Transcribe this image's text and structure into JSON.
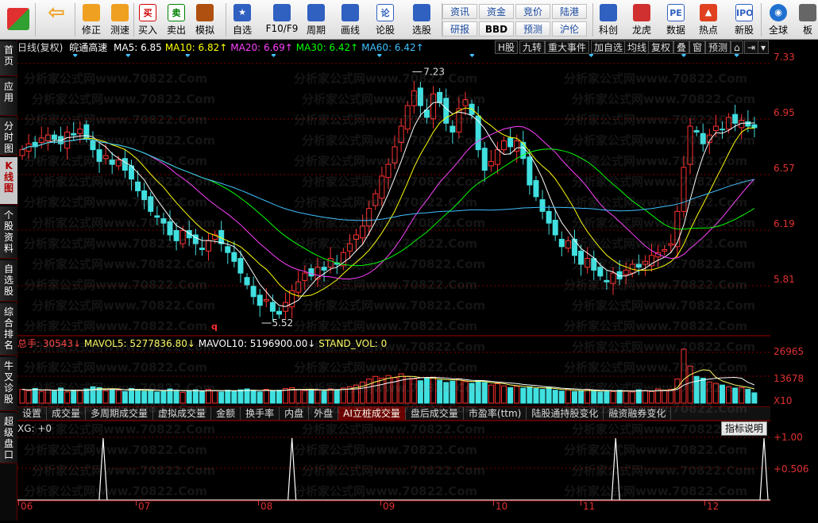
{
  "toolbar": {
    "buttons": [
      {
        "label": "",
        "name": "home-button",
        "icon": "app-logo",
        "color": "#e03030"
      },
      {
        "label": "",
        "name": "back-button",
        "icon": "arrow-left",
        "color": "#f0a020"
      },
      {
        "label": "修正",
        "name": "repair-button",
        "icon": "clock-icon",
        "color": "#f0a020"
      },
      {
        "label": "测速",
        "name": "speedtest-button",
        "icon": "stopwatch-icon",
        "color": "#f0a020"
      },
      {
        "label": "买入",
        "name": "buy-button",
        "icon": "buy-icon",
        "color": "#d00000",
        "glyph": "买"
      },
      {
        "label": "卖出",
        "name": "sell-button",
        "icon": "sell-icon",
        "color": "#008000",
        "glyph": "卖"
      },
      {
        "label": "模拟",
        "name": "simulate-button",
        "icon": "hammer-icon",
        "color": "#b05010"
      },
      {
        "label": "自选",
        "name": "watchlist-button",
        "icon": "star-icon",
        "color": "#3060c0"
      },
      {
        "label": "F10/F9",
        "name": "f10-button",
        "icon": "doc-icon",
        "color": "#3060c0"
      },
      {
        "label": "周期",
        "name": "period-button",
        "icon": "cycle-icon",
        "color": "#3060c0"
      },
      {
        "label": "画线",
        "name": "drawline-button",
        "icon": "pen-icon",
        "color": "#3060c0"
      },
      {
        "label": "论股",
        "name": "forum-button",
        "icon": "forum-icon",
        "color": "#3060c0",
        "glyph": "论"
      },
      {
        "label": "选股",
        "name": "stockpick-button",
        "icon": "gauge-icon",
        "color": "#3060c0"
      },
      {
        "label": "科创",
        "name": "star-market-button",
        "icon": "chart-icon",
        "color": "#3060c0"
      },
      {
        "label": "龙虎",
        "name": "dragon-tiger-button",
        "icon": "dragon-icon",
        "color": "#d03030"
      },
      {
        "label": "数据",
        "name": "data-button",
        "icon": "pe-icon",
        "color": "#3060c0",
        "glyph": "PE"
      },
      {
        "label": "热点",
        "name": "hotspot-button",
        "icon": "fire-icon",
        "color": "#e04020"
      },
      {
        "label": "新股",
        "name": "ipo-button",
        "icon": "ipo-icon",
        "color": "#3060c0",
        "glyph": "IPO"
      },
      {
        "label": "全球",
        "name": "global-button",
        "icon": "globe-icon",
        "color": "#2070d0"
      },
      {
        "label": "板",
        "name": "sector-button",
        "icon": "sector-icon",
        "color": "#666"
      }
    ],
    "mini": [
      {
        "label": "资讯",
        "name": "news-button"
      },
      {
        "label": "资金",
        "name": "fund-button"
      },
      {
        "label": "竞价",
        "name": "auction-button"
      },
      {
        "label": "陆港",
        "name": "connect-button"
      },
      {
        "label": "研报",
        "name": "research-button"
      },
      {
        "label": "BBD",
        "name": "bbd-button"
      },
      {
        "label": "预测",
        "name": "forecast-button"
      },
      {
        "label": "沪伦",
        "name": "shanghai-london-button"
      }
    ]
  },
  "sidetabs": [
    {
      "label": "首页",
      "name": "tab-home"
    },
    {
      "label": "应用",
      "name": "tab-apps",
      "arrow": true
    },
    {
      "label": "分时图",
      "name": "tab-intraday"
    },
    {
      "label": "K线图",
      "name": "tab-kline",
      "active": true
    },
    {
      "label": "个股资料",
      "name": "tab-stock-info"
    },
    {
      "label": "自选股",
      "name": "tab-watchlist"
    },
    {
      "label": "综合排名",
      "name": "tab-ranking"
    },
    {
      "label": "牛叉诊股",
      "name": "tab-diagnosis"
    },
    {
      "label": "超级盘口",
      "name": "tab-super-orderbook"
    }
  ],
  "chart_head": {
    "period": "日线(复权)",
    "stock": "皖通高速",
    "ma": [
      {
        "label": "MA5: 6.85",
        "color": "#ffffff"
      },
      {
        "label": "MA10: 6.82↑",
        "color": "#ffff00"
      },
      {
        "label": "MA20: 6.69↑",
        "color": "#ff40ff"
      },
      {
        "label": "MA30: 6.42↑",
        "color": "#00ff00"
      },
      {
        "label": "MA60: 6.42↑",
        "color": "#40c0ff"
      }
    ],
    "menu": [
      "H股",
      "九转",
      "重大事件",
      "加自选",
      "均线",
      "复权",
      "叠",
      "窗",
      "预测"
    ]
  },
  "price_axis": [
    "7.33",
    "6.95",
    "6.57",
    "6.19",
    "5.81"
  ],
  "price_annotations": {
    "high": "7.23",
    "low": "5.52"
  },
  "volume_head": {
    "total": "总手: 30543↓",
    "mavol5": "MAVOL5: 5277836.80↓",
    "mavol10": "MAVOL10: 5196900.00↓",
    "stand": "STAND_VOL: 0"
  },
  "volume_axis": [
    "26965",
    "13678",
    "X10"
  ],
  "indicator_tabs": [
    {
      "label": "设置",
      "name": "itab-settings"
    },
    {
      "label": "成交量",
      "name": "itab-volume"
    },
    {
      "label": "多周期成交量",
      "name": "itab-multi-volume"
    },
    {
      "label": "虚拟成交量",
      "name": "itab-virtual-volume"
    },
    {
      "label": "金额",
      "name": "itab-amount"
    },
    {
      "label": "换手率",
      "name": "itab-turnover"
    },
    {
      "label": "内盘",
      "name": "itab-inner"
    },
    {
      "label": "外盘",
      "name": "itab-outer"
    },
    {
      "label": "AI立桩成交量",
      "name": "itab-ai-volume",
      "active": true
    },
    {
      "label": "盘后成交量",
      "name": "itab-after-hours"
    },
    {
      "label": "市盈率(ttm)",
      "name": "itab-pe"
    },
    {
      "label": "陆股通持股变化",
      "name": "itab-connect-holding"
    },
    {
      "label": "融资融券变化",
      "name": "itab-margin"
    }
  ],
  "xg_head": "XG: +0",
  "help_label": "指标说明",
  "xg_axis": [
    "+1.00",
    "+0.506"
  ],
  "date_axis": [
    "06",
    "07",
    "08",
    "09",
    "10",
    "11",
    "12"
  ],
  "watermark": "分析家公式网www.70822.Com",
  "colors": {
    "up": "#ff3030",
    "down": "#40e0e0",
    "grid": "#7a0000",
    "ma5": "#ffffff",
    "ma10": "#ffff00",
    "ma20": "#ff40ff",
    "ma30": "#00ff00",
    "ma60": "#40c0ff"
  },
  "chart_data": {
    "type": "candlestick",
    "title": "皖通高速 日线(复权)",
    "ylim": [
      5.45,
      7.33
    ],
    "price_high": 7.23,
    "price_low": 5.52,
    "months": [
      "06",
      "07",
      "08",
      "09",
      "10",
      "11",
      "12"
    ],
    "closes": [
      6.7,
      6.74,
      6.72,
      6.78,
      6.8,
      6.77,
      6.74,
      6.82,
      6.8,
      6.84,
      6.78,
      6.7,
      6.62,
      6.66,
      6.6,
      6.63,
      6.56,
      6.5,
      6.42,
      6.36,
      6.28,
      6.24,
      6.2,
      6.12,
      6.08,
      6.15,
      6.1,
      6.06,
      6.02,
      6.08,
      6.12,
      6.06,
      6.0,
      5.94,
      5.86,
      5.78,
      5.7,
      5.64,
      5.68,
      5.6,
      5.58,
      5.66,
      5.74,
      5.8,
      5.86,
      5.84,
      5.9,
      5.88,
      5.96,
      5.92,
      6.0,
      6.06,
      6.12,
      6.18,
      6.3,
      6.4,
      6.52,
      6.6,
      6.72,
      6.86,
      7.0,
      7.1,
      7.0,
      6.92,
      7.08,
      7.02,
      6.88,
      6.82,
      6.98,
      7.04,
      6.94,
      6.7,
      6.56,
      6.62,
      6.7,
      6.76,
      6.72,
      6.76,
      6.64,
      6.46,
      6.38,
      6.28,
      6.2,
      6.12,
      6.04,
      6.08,
      5.98,
      5.92,
      5.96,
      5.88,
      5.84,
      5.8,
      5.86,
      5.82,
      5.88,
      5.92,
      5.9,
      5.94,
      5.98,
      6.0,
      6.02,
      6.06,
      6.28,
      6.58,
      6.86,
      6.82,
      6.74,
      6.8,
      6.86,
      6.84,
      6.92,
      6.88,
      6.9,
      6.86,
      6.85
    ],
    "volumes": [
      3.2,
      2.9,
      3.4,
      2.7,
      3.1,
      2.8,
      3.5,
      2.6,
      3.0,
      2.9,
      3.3,
      3.8,
      3.6,
      2.9,
      3.2,
      3.0,
      2.7,
      3.4,
      3.1,
      2.8,
      3.0,
      2.6,
      2.9,
      3.3,
      3.0,
      2.5,
      2.8,
      3.1,
      2.7,
      3.2,
      2.9,
      2.6,
      3.0,
      2.8,
      3.1,
      3.3,
      2.9,
      2.6,
      3.2,
      2.8,
      3.0,
      3.4,
      3.6,
      3.1,
      2.9,
      3.2,
      3.0,
      2.8,
      3.3,
      3.1,
      3.5,
      3.8,
      4.2,
      4.9,
      5.6,
      6.2,
      5.8,
      6.4,
      5.9,
      6.8,
      6.2,
      5.6,
      5.2,
      5.8,
      6.0,
      5.3,
      4.8,
      5.1,
      5.6,
      5.0,
      4.6,
      5.2,
      4.8,
      4.2,
      4.5,
      4.0,
      3.6,
      3.9,
      3.5,
      3.8,
      3.4,
      3.2,
      3.6,
      3.0,
      2.8,
      3.1,
      2.7,
      2.9,
      3.2,
      2.8,
      2.6,
      2.9,
      2.7,
      3.0,
      2.8,
      2.6,
      3.1,
      2.9,
      2.7,
      3.3,
      3.0,
      3.2,
      5.6,
      12.5,
      8.6,
      6.2,
      5.8,
      4.9,
      4.6,
      4.2,
      3.8,
      3.5,
      3.6,
      3.2,
      2.4
    ],
    "xg_signal_indices": [
      12,
      40,
      88,
      110
    ]
  }
}
